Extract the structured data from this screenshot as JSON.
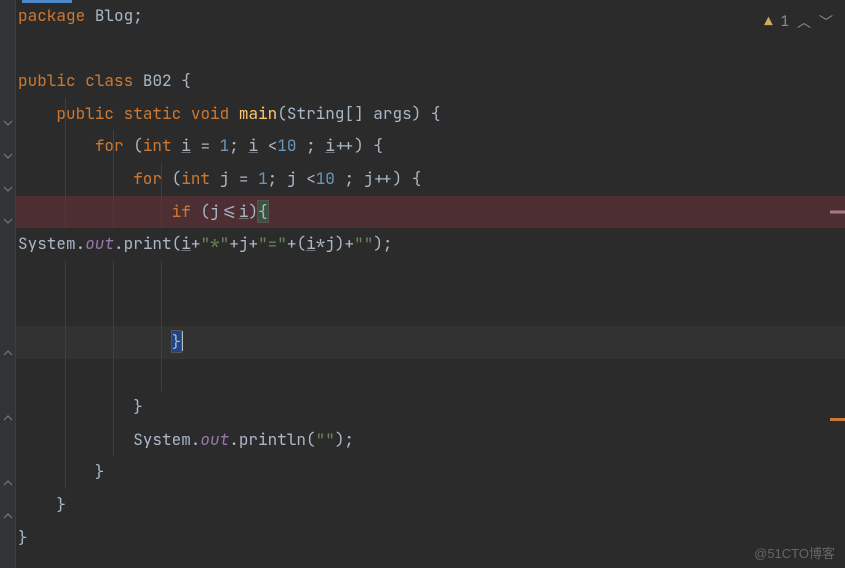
{
  "top_right": {
    "warning_count": "1"
  },
  "watermark": "@51CTO博客",
  "code": {
    "l1": {
      "package": "package",
      "pkgname": "Blog",
      "semi": ";"
    },
    "l3": {
      "pub": "public",
      "cls": "class",
      "name": "B02",
      "open": " {"
    },
    "l4": {
      "indent": "    ",
      "pub": "public",
      "stat": "static",
      "void": "void",
      "main": "main",
      "args": "(String[] args) {"
    },
    "l5": {
      "indent": "        ",
      "for": "for",
      "open": " (",
      "int": "int",
      "var": "i",
      "eq": " = ",
      "one": "1",
      "semi1": "; ",
      "var2": "i",
      "lt": " <",
      "ten": "10",
      "semi2": " ; ",
      "var3": "i",
      "inc": "++) {"
    },
    "l6": {
      "indent": "            ",
      "for": "for",
      "open": " (",
      "int": "int",
      "var": "j",
      "eq": " = ",
      "one": "1",
      "semi1": "; ",
      "var2": "j",
      "lt": " <",
      "ten": "10",
      "semi2": " ; ",
      "var3": "j",
      "inc": "++) {"
    },
    "l7": {
      "indent": "                ",
      "if": "if",
      "open": " (",
      "j": "j",
      "op": "<=",
      "i": "i",
      "close": ")",
      "brace": "{"
    },
    "l8": {
      "sys": "System.",
      "out": "out",
      "dot": ".print(",
      "i": "i",
      "p1": "+",
      "s1": "\"*\"",
      "p2": "+",
      "j": "j",
      "p3": "+",
      "s2": "\"=\"",
      "p4": "+(",
      "i2": "i",
      "mul": "*",
      "j2": "j",
      "p5": ")+",
      "s3": "\"\"",
      "end": ");"
    },
    "l11": {
      "indent": "                ",
      "brace": "}"
    },
    "l13": {
      "indent": "            }",
      "text": ""
    },
    "l14": {
      "indent": "            ",
      "sys": "System.",
      "out": "out",
      "dot": ".println(",
      "s": "\"\"",
      "end": ");"
    },
    "l15": {
      "indent": "        }"
    },
    "l16": {
      "indent": "    }"
    },
    "l17": {
      "indent": "}"
    }
  }
}
